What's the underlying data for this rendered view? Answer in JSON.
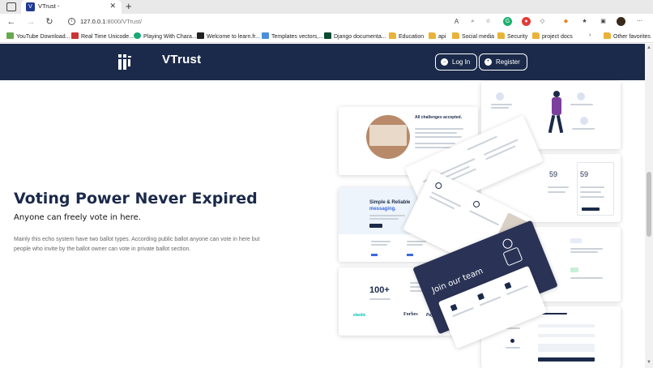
{
  "browser": {
    "tab_title": "VTrust -",
    "url_host": "127.0.0.1",
    "url_path": ":8000/VTrust/",
    "bookmarks": [
      "YouTube Download...",
      "Real Time Unicode...",
      "Playing With Chara...",
      "Welcome to learn.fr...",
      "Templates vectors,...",
      "Django documenta...",
      "Education",
      "api",
      "Social media",
      "Security",
      "project docs",
      "Other favorites"
    ]
  },
  "header": {
    "brand": "VTrust",
    "login_label": "Log In",
    "register_label": "Register"
  },
  "hero": {
    "title": "Voting Power Never Expired",
    "subtitle": "Anyone can freely vote in here.",
    "description": "Mainly this echo system have two ballot types. According public ballot anyone can vote in here but people who invite by the ballot owner can vote in private ballot section."
  },
  "collage": {
    "card_challenge_title": "All challenges accepted.",
    "card_simple_title": "Simple & Reliable",
    "card_simple_accent": "messaging.",
    "card_stat": "100+",
    "card_team": "Join our team",
    "card_price_left": "59",
    "card_price_right": "59",
    "brand_logos": [
      "elastic",
      "Forbes",
      "PayPal"
    ]
  },
  "colors": {
    "header_bg": "#1b2a4a",
    "accent": "#3b6ae0"
  }
}
